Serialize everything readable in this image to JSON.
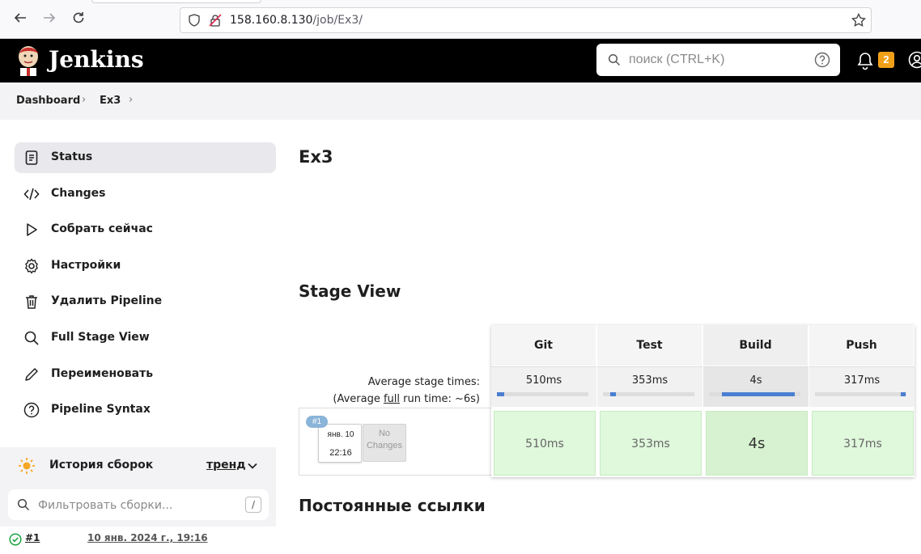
{
  "browser": {
    "url_host": "158.160.8.130",
    "url_path": "/job/Ex3/"
  },
  "header": {
    "brand": "Jenkins",
    "search_placeholder": "поиск (CTRL+K)",
    "notification_count": "2",
    "colors": {
      "header_bg": "#000000",
      "badge": "#f0a018"
    }
  },
  "breadcrumb": [
    "Dashboard",
    "Ex3"
  ],
  "sidebar": {
    "items": [
      {
        "label": "Status",
        "icon": "status-document-icon",
        "active": true
      },
      {
        "label": "Changes",
        "icon": "code-icon"
      },
      {
        "label": "Собрать сейчас",
        "icon": "play-icon"
      },
      {
        "label": "Настройки",
        "icon": "gear-icon"
      },
      {
        "label": "Удалить Pipeline",
        "icon": "trash-icon"
      },
      {
        "label": "Full Stage View",
        "icon": "search-icon"
      },
      {
        "label": "Переименовать",
        "icon": "pencil-icon"
      },
      {
        "label": "Pipeline Syntax",
        "icon": "help-icon"
      }
    ],
    "history": {
      "title": "История сборок",
      "trend": "тренд",
      "filter_placeholder": "Фильтровать сборки...",
      "filter_shortcut": "/",
      "builds": [
        {
          "number": "#1",
          "date": "10 янв. 2024 г., 19:16",
          "status": "success"
        }
      ]
    }
  },
  "main": {
    "job_title": "Ex3",
    "stage_view_title": "Stage View",
    "permalinks_title": "Постоянные ссылки",
    "avg_stage_label": "Average stage times:",
    "avg_full_prefix": "(Average ",
    "avg_full_word": "full",
    "avg_full_suffix": " run time: ~6s)",
    "stages": [
      {
        "name": "Git",
        "avg": "510ms",
        "run": "510ms",
        "bar_start": 0.0,
        "bar_fill": 0.08
      },
      {
        "name": "Test",
        "avg": "353ms",
        "run": "353ms",
        "bar_start": 0.08,
        "bar_fill": 0.06
      },
      {
        "name": "Build",
        "avg": "4s",
        "run": "4s",
        "bar_start": 0.14,
        "bar_fill": 0.8
      },
      {
        "name": "Push",
        "avg": "317ms",
        "run": "317ms",
        "bar_start": 0.94,
        "bar_fill": 0.05
      }
    ],
    "run": {
      "badge": "#1",
      "date": "янв. 10",
      "time": "22:16",
      "changes": "No Changes"
    }
  }
}
